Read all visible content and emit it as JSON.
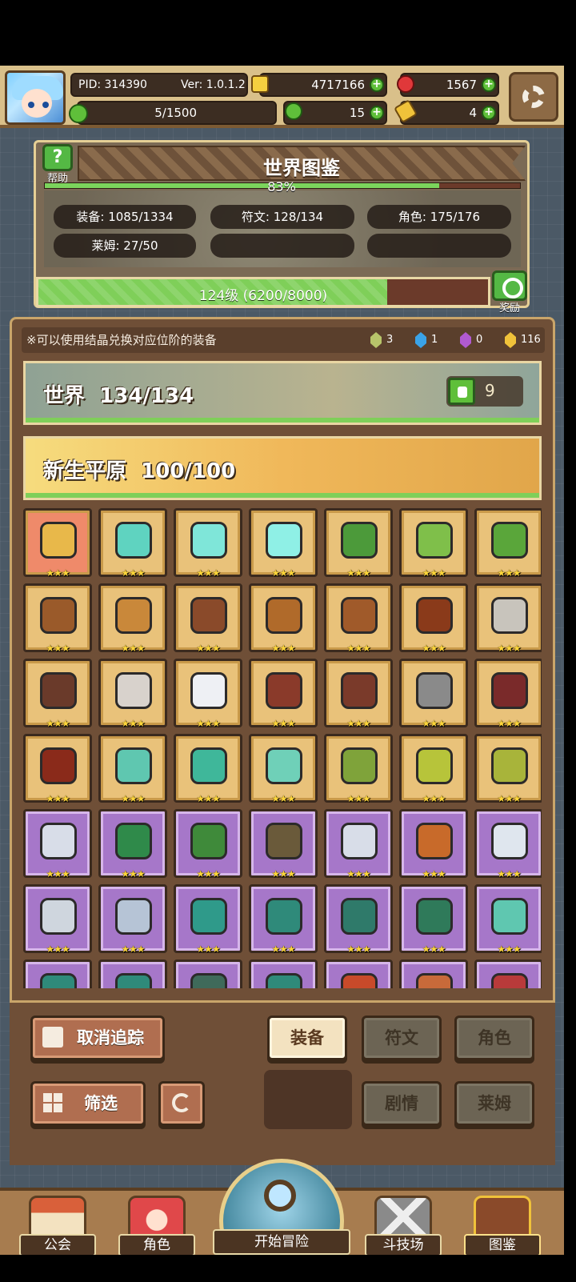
{
  "header": {
    "pid": "PID: 314390",
    "version": "Ver: 1.0.1.2",
    "energy": "5/1500",
    "gold": "4717166",
    "ruby": "1567",
    "clover": "15",
    "key": "4"
  },
  "dex": {
    "title": "世界图鉴",
    "help_label": "帮助",
    "percent_text": "83%",
    "percent": 83,
    "stats": {
      "equip": "装备: 1085/1334",
      "rune": "符文: 128/134",
      "role": "角色: 175/176",
      "slime": "莱姆: 27/50"
    },
    "level_text": "124级 (6200/8000)",
    "level_progress": 0.775,
    "reward_label": "奖励"
  },
  "tip": "※可以使用结晶兑换对应位阶的装备",
  "crystals": [
    "3",
    "1",
    "0",
    "116"
  ],
  "crystal_colors": [
    "#b7c46a",
    "#3aa3e8",
    "#b15ad0",
    "#f0c23a"
  ],
  "world_banner": {
    "name": "世界",
    "count": "134/134",
    "likes": "9"
  },
  "plain_banner": {
    "name": "新生平原",
    "count": "100/100"
  },
  "item_stars": "★★★",
  "items": [
    {
      "bg": "red",
      "icon": "straw-hat-icon",
      "color": "#e8b84a"
    },
    {
      "bg": "gold",
      "icon": "staff-icon",
      "color": "#5fd3c0"
    },
    {
      "bg": "gold",
      "icon": "orb-icon",
      "color": "#7fe6d9"
    },
    {
      "bg": "gold",
      "icon": "crystal-icon",
      "color": "#8ff0e6"
    },
    {
      "bg": "gold",
      "icon": "hood-icon",
      "color": "#4c9a3a"
    },
    {
      "bg": "gold",
      "icon": "armor-icon",
      "color": "#7fbf4a"
    },
    {
      "bg": "gold",
      "icon": "ring-icon",
      "color": "#5aa63a"
    },
    {
      "bg": "gold",
      "icon": "crossbow-icon",
      "color": "#9a5a2a"
    },
    {
      "bg": "gold",
      "icon": "spear-icon",
      "color": "#c9883a"
    },
    {
      "bg": "gold",
      "icon": "necklace-icon",
      "color": "#8a4a2a"
    },
    {
      "bg": "gold",
      "icon": "hammer-icon",
      "color": "#b06a2a"
    },
    {
      "bg": "gold",
      "icon": "ring-icon",
      "color": "#a05a2a"
    },
    {
      "bg": "gold",
      "icon": "amulet-icon",
      "color": "#8a3a1a"
    },
    {
      "bg": "gold",
      "icon": "axe-icon",
      "color": "#c8c4bc"
    },
    {
      "bg": "gold",
      "icon": "ring-icon",
      "color": "#6a3a2a"
    },
    {
      "bg": "gold",
      "icon": "ring-icon",
      "color": "#d8d2cc"
    },
    {
      "bg": "gold",
      "icon": "pearl-icon",
      "color": "#eef0f4"
    },
    {
      "bg": "gold",
      "icon": "bracer-icon",
      "color": "#8a3a2a"
    },
    {
      "bg": "gold",
      "icon": "necklace-icon",
      "color": "#7a3a2a"
    },
    {
      "bg": "gold",
      "icon": "sword-icon",
      "color": "#8a8a8a"
    },
    {
      "bg": "gold",
      "icon": "hood-icon",
      "color": "#7a2a2a"
    },
    {
      "bg": "gold",
      "icon": "armor-icon",
      "color": "#8a2a1a"
    },
    {
      "bg": "gold",
      "icon": "bow-icon",
      "color": "#5fc7b0"
    },
    {
      "bg": "gold",
      "icon": "spear-icon",
      "color": "#3fb79a"
    },
    {
      "bg": "gold",
      "icon": "boots-icon",
      "color": "#6fd0b8"
    },
    {
      "bg": "gold",
      "icon": "hood-icon",
      "color": "#7fa33a"
    },
    {
      "bg": "gold",
      "icon": "scroll-icon",
      "color": "#b7c43a"
    },
    {
      "bg": "gold",
      "icon": "crown-icon",
      "color": "#a8b43a"
    },
    {
      "bg": "purple",
      "icon": "sword-icon",
      "color": "#d8dde8"
    },
    {
      "bg": "purple",
      "icon": "hood-icon",
      "color": "#2f8a4a"
    },
    {
      "bg": "purple",
      "icon": "armor-icon",
      "color": "#3f8a3a"
    },
    {
      "bg": "purple",
      "icon": "crossbow-icon",
      "color": "#6a5a3a"
    },
    {
      "bg": "purple",
      "icon": "spear-icon",
      "color": "#d8dde8"
    },
    {
      "bg": "purple",
      "icon": "gloves-icon",
      "color": "#c86a2a"
    },
    {
      "bg": "purple",
      "icon": "armor-icon",
      "color": "#dfe6ee"
    },
    {
      "bg": "purple",
      "icon": "ring-icon",
      "color": "#cfd6de"
    },
    {
      "bg": "purple",
      "icon": "boots-icon",
      "color": "#b6c4d6"
    },
    {
      "bg": "purple",
      "icon": "staff-icon",
      "color": "#2f9a8a"
    },
    {
      "bg": "purple",
      "icon": "hat-icon",
      "color": "#2f8a7a"
    },
    {
      "bg": "purple",
      "icon": "armor-icon",
      "color": "#2f7a6a"
    },
    {
      "bg": "purple",
      "icon": "bracer-icon",
      "color": "#2f7a5a"
    },
    {
      "bg": "purple",
      "icon": "gem-icon",
      "color": "#5fc7b0"
    },
    {
      "bg": "purple",
      "icon": "gloves-icon",
      "color": "#2f8a7a"
    },
    {
      "bg": "purple",
      "icon": "hat-icon",
      "color": "#2f8a7a"
    },
    {
      "bg": "purple",
      "icon": "necklace-icon",
      "color": "#3f6a5a"
    },
    {
      "bg": "purple",
      "icon": "staff-icon",
      "color": "#2f8a7a"
    },
    {
      "bg": "purple",
      "icon": "helmet-icon",
      "color": "#c84a2a"
    },
    {
      "bg": "purple",
      "icon": "armor-icon",
      "color": "#c86a3a"
    },
    {
      "bg": "purple",
      "icon": "gauntlet-icon",
      "color": "#b83a3a"
    }
  ],
  "controls": {
    "untrack": "取消追踪",
    "filter": "筛选",
    "tab_equip": "装备",
    "tab_rune": "符文",
    "tab_role": "角色",
    "tab_story": "剧情",
    "tab_slime": "莱姆"
  },
  "nav": {
    "guild": "公会",
    "role": "角色",
    "start": "开始冒险",
    "arena": "斗技场",
    "dex": "图鉴"
  }
}
